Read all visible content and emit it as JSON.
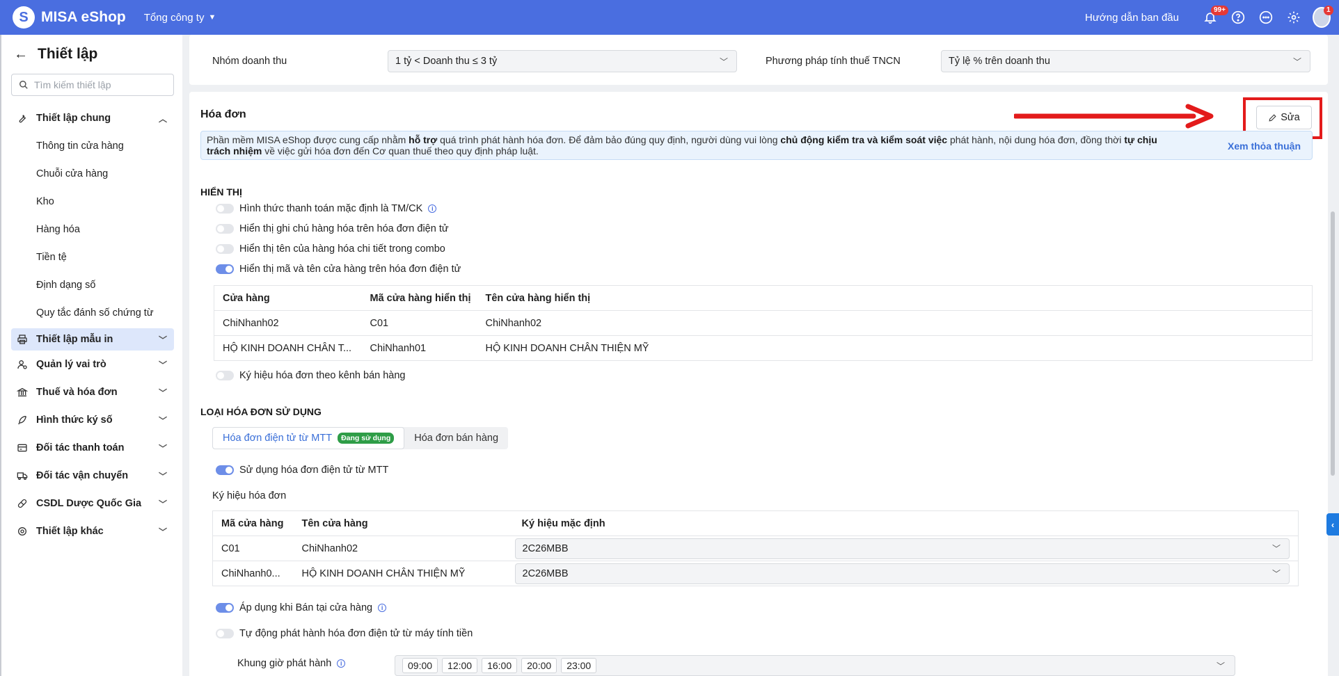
{
  "topbar": {
    "app_name": "MISA eShop",
    "company": "Tổng công ty",
    "guide_link": "Hướng dẫn ban đầu",
    "notification_badge": "99+",
    "avatar_badge": "1",
    "accent_color": "#4a6ee0"
  },
  "sidebar": {
    "title": "Thiết lập",
    "search_placeholder": "Tìm kiếm thiết lập",
    "groups": [
      {
        "label": "Thiết lập chung",
        "icon": "wrench-icon",
        "expanded": true,
        "items": [
          "Thông tin cửa hàng",
          "Chuỗi cửa hàng",
          "Kho",
          "Hàng hóa",
          "Tiền tệ",
          "Định dạng số",
          "Quy tắc đánh số chứng từ"
        ]
      },
      {
        "label": "Thiết lập mẫu in",
        "icon": "printer-icon",
        "active": true
      },
      {
        "label": "Quản lý vai trò",
        "icon": "user-role-icon"
      },
      {
        "label": "Thuế và hóa đơn",
        "icon": "bank-icon"
      },
      {
        "label": "Hình thức ký số",
        "icon": "feather-icon"
      },
      {
        "label": "Đối tác thanh toán",
        "icon": "card-icon"
      },
      {
        "label": "Đối tác vận chuyển",
        "icon": "truck-icon"
      },
      {
        "label": "CSDL Dược Quốc Gia",
        "icon": "pill-icon"
      },
      {
        "label": "Thiết lập khác",
        "icon": "gear-icon"
      }
    ]
  },
  "revenue": {
    "group_label": "Nhóm doanh thu",
    "group_value": "1 tỷ < Doanh thu ≤ 3 tỷ",
    "tax_label": "Phương pháp tính thuế TNCN",
    "tax_value": "Tỷ lệ % trên doanh thu"
  },
  "invoice": {
    "title": "Hóa đơn",
    "edit_label": "Sửa",
    "notice": {
      "p1": "Phần mềm MISA eShop được cung cấp nhằm ",
      "b1": "hỗ trợ",
      "p2": " quá trình phát hành hóa đơn. Để đảm bảo đúng quy định, người dùng vui lòng ",
      "b2": "chủ động kiểm tra và kiểm soát việc",
      "p3": " phát hành, nội dung hóa đơn, đồng thời ",
      "b3": "tự chịu trách nhiệm",
      "p4": " về việc gửi hóa đơn đến Cơ quan thuế theo quy định pháp luật.",
      "link": "Xem thỏa thuận"
    },
    "display": {
      "title": "HIỂN THỊ",
      "toggles": [
        {
          "label": "Hình thức thanh toán mặc định là TM/CK",
          "on": false
        },
        {
          "label": "Hiển thị ghi chú hàng hóa trên hóa đơn điện tử",
          "on": false
        },
        {
          "label": "Hiển thị tên của hàng hóa chi tiết trong combo",
          "on": false
        },
        {
          "label": "Hiển thị mã và tên cửa hàng trên hóa đơn điện tử",
          "on": true
        }
      ],
      "store_table": {
        "headers": [
          "Cửa hàng",
          "Mã cửa hàng hiển thị",
          "Tên cửa hàng hiển thị"
        ],
        "rows": [
          [
            "ChiNhanh02",
            "C01",
            "ChiNhanh02"
          ],
          [
            "HỘ KINH DOANH CHÂN T...",
            "ChiNhanh01",
            "HỘ KINH DOANH CHÂN THIỆN MỸ"
          ]
        ]
      },
      "symbol_toggle": {
        "label": "Ký hiệu hóa đơn theo kênh bán hàng",
        "on": false
      }
    },
    "types": {
      "title": "LOẠI HÓA ĐƠN SỬ DỤNG",
      "tab_active": "Hóa đơn điện tử từ MTT",
      "tab_active_tag": "Đang sử dụng",
      "tab_other": "Hóa đơn bán hàng",
      "use_mtt": {
        "label": "Sử dụng hóa đơn điện tử từ MTT",
        "on": true
      },
      "symbol_title": "Ký hiệu hóa đơn",
      "symbol_table": {
        "headers": [
          "Mã cửa hàng",
          "Tên cửa hàng",
          "Ký hiệu mặc định"
        ],
        "rows": [
          [
            "C01",
            "ChiNhanh02",
            "2C26MBB"
          ],
          [
            "ChiNhanh0...",
            "HỘ KINH DOANH CHÂN THIỆN MỸ",
            "2C26MBB"
          ]
        ]
      },
      "apply_store": {
        "label": "Áp dụng khi Bán tại cửa hàng",
        "on": true
      },
      "auto_issue": {
        "label": "Tự động phát hành hóa đơn điện tử từ máy tính tiền",
        "on": false
      },
      "time_label": "Khung giờ phát hành",
      "times": [
        "09:00",
        "12:00",
        "16:00",
        "20:00",
        "23:00"
      ]
    }
  }
}
